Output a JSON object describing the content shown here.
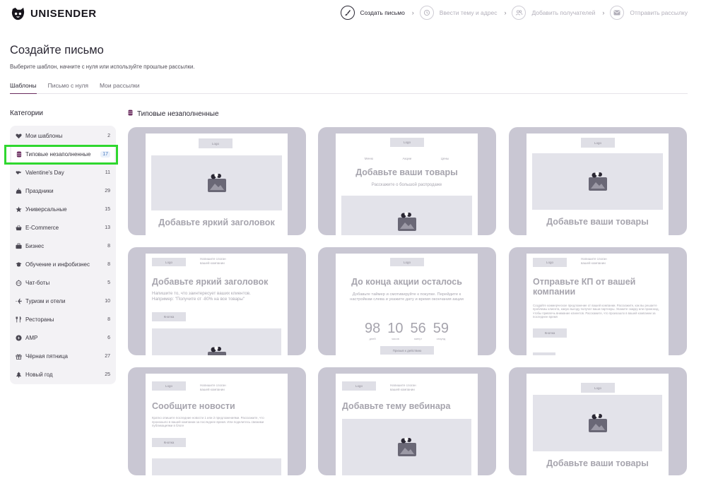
{
  "brand": {
    "name": "UNISENDER"
  },
  "steps": [
    {
      "label": "Создать письмо",
      "icon": "brush-icon",
      "active": true
    },
    {
      "label": "Ввести тему и адрес",
      "icon": "clock-icon",
      "active": false
    },
    {
      "label": "Добавить получателей",
      "icon": "users-icon",
      "active": false
    },
    {
      "label": "Отправить рассылку",
      "icon": "envelope-icon",
      "active": false
    }
  ],
  "page": {
    "title": "Создайте письмо",
    "subtitle": "Выберите шаблон, начните с нуля или используйте прошлые рассылки."
  },
  "tabs": [
    {
      "label": "Шаблоны",
      "active": true
    },
    {
      "label": "Письмо с нуля",
      "active": false
    },
    {
      "label": "Мои рассылки",
      "active": false
    }
  ],
  "categories": {
    "title": "Категории",
    "items": [
      {
        "label": "Мои шаблоны",
        "count": "2",
        "icon": "heart-icon"
      },
      {
        "label": "Типовые незаполненные",
        "count": "17",
        "icon": "barrel-icon",
        "active": true
      },
      {
        "label": "Valentine's Day",
        "count": "11",
        "icon": "hearts-icon"
      },
      {
        "label": "Праздники",
        "count": "29",
        "icon": "cake-icon"
      },
      {
        "label": "Универсальные",
        "count": "15",
        "icon": "star-icon"
      },
      {
        "label": "E-Commerce",
        "count": "13",
        "icon": "basket-icon"
      },
      {
        "label": "Бизнес",
        "count": "8",
        "icon": "briefcase-icon"
      },
      {
        "label": "Обучение и инфобизнес",
        "count": "8",
        "icon": "graduation-cap-icon"
      },
      {
        "label": "Чат-боты",
        "count": "5",
        "icon": "robot-icon"
      },
      {
        "label": "Туризм и отели",
        "count": "10",
        "icon": "airplane-icon"
      },
      {
        "label": "Рестораны",
        "count": "8",
        "icon": "cutlery-icon"
      },
      {
        "label": "AMP",
        "count": "6",
        "icon": "amp-bolt-icon"
      },
      {
        "label": "Чёрная пятница",
        "count": "27",
        "icon": "gift-icon"
      },
      {
        "label": "Новый год",
        "count": "25",
        "icon": "tree-icon"
      }
    ]
  },
  "section": {
    "title": "Типовые незаполненные",
    "icon": "barrel-icon"
  },
  "templates": {
    "logo": "Logo",
    "menu": [
      "Меню",
      "Акции",
      "Цены"
    ],
    "header_links": "Напишите слоган вашей компании",
    "button": "Кнопка",
    "button_action": "Призыв к действию",
    "t1": {
      "heading": "Добавьте яркий заголовок"
    },
    "t2": {
      "heading": "Добавьте ваши товары",
      "sub": "Расскажите о большой распродаже"
    },
    "t3": {
      "heading": "Добавьте ваши товары"
    },
    "t4": {
      "heading": "Добавьте яркий заголовок",
      "text": "Напишите то, что заинтересует ваших клиентов. Например: \"Получите от -80% на все товары\""
    },
    "t5": {
      "heading": "До конца акции осталось",
      "text": "Добавьте таймер и смотивируйте к покупке. Перейдите к настройкам слева и укажите дату и время окончания акции",
      "timer": [
        {
          "value": "98",
          "unit": "дней"
        },
        {
          "value": "10",
          "unit": "часов"
        },
        {
          "value": "56",
          "unit": "минут"
        },
        {
          "value": "59",
          "unit": "секунд"
        }
      ]
    },
    "t6": {
      "heading": "Отправьте КП от вашей компании",
      "text": "Создайте коммерческое предложение от вашей компании. Расскажите, как вы решаете проблемы клиента, какую выгоду получат ваши партнеры. Укажите скидку или промокод, чтобы привлечь внимание клиентов. Расскажите, что произошло в вашей компании за последнее время"
    },
    "t7": {
      "heading": "Сообщите новости",
      "text": "Кратко опишите последние новости 1 или 2 предложениями. Расскажите, что произошло в вашей компании за последнее время. Или поделитесь свежими публикациями в блоге"
    },
    "t8": {
      "heading": "Добавьте тему вебинара"
    },
    "t9": {
      "heading": "Добавьте ваши товары"
    }
  },
  "colors": {
    "accent": "#6a2c5f",
    "card_bg": "#c9c7d3",
    "highlight": "#2fd72f"
  }
}
